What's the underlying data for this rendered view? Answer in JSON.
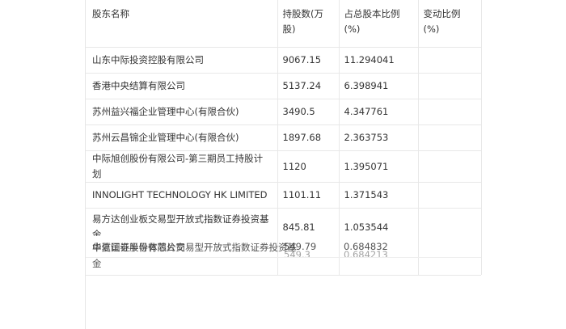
{
  "table": {
    "headers": {
      "name": "股东名称",
      "shares": "持股数(万股)",
      "ratio": "占总股本比例(%)",
      "change": "变动比例(%)"
    },
    "rows": [
      {
        "name": "山东中际投资控股有限公司",
        "shares": "9067.15",
        "ratio": "11.294041",
        "change": ""
      },
      {
        "name": "香港中央结算有限公司",
        "shares": "5137.24",
        "ratio": "6.398941",
        "change": ""
      },
      {
        "name": "苏州益兴福企业管理中心(有限合伙)",
        "shares": "3490.5",
        "ratio": "4.347761",
        "change": ""
      },
      {
        "name": "苏州云昌锦企业管理中心(有限合伙)",
        "shares": "1897.68",
        "ratio": "2.363753",
        "change": ""
      },
      {
        "name": "中际旭创股份有限公司-第三期员工持股计划",
        "shares": "1120",
        "ratio": "1.395071",
        "change": ""
      },
      {
        "name": "INNOLIGHT TECHNOLOGY HK LIMITED",
        "shares": "1101.11",
        "ratio": "1.371543",
        "change": ""
      },
      {
        "name": "易方达创业板交易型开放式指数证券投资基金",
        "shares": "845.81",
        "ratio": "1.053544",
        "change": ""
      }
    ],
    "overlapping_rows": {
      "name_a": "中信证券股份有限公司",
      "name_b": "华夏国证半导体芯片交易型开放式指数证券投资基",
      "name_c": "金",
      "shares_a": "549.79",
      "shares_b": "549.3",
      "ratio_a": "0.684832",
      "ratio_b": "0.684213"
    }
  }
}
